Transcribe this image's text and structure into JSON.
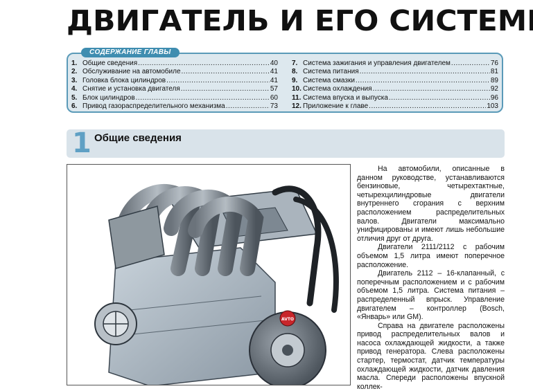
{
  "title": "ДВИГАТЕЛЬ И ЕГО СИСТЕМЫ",
  "toc": {
    "header": "СОДЕРЖАНИЕ ГЛАВЫ",
    "left": [
      {
        "num": "1.",
        "text": "Общие сведения",
        "page": "40"
      },
      {
        "num": "2.",
        "text": "Обслуживание на автомобиле",
        "page": "41"
      },
      {
        "num": "3.",
        "text": "Головка блока цилиндров",
        "page": "41"
      },
      {
        "num": "4.",
        "text": "Снятие и установка двигателя",
        "page": "57"
      },
      {
        "num": "5.",
        "text": "Блок цилиндров",
        "page": "60"
      },
      {
        "num": "6.",
        "text": "Привод газораспределительного механизма",
        "page": "73"
      }
    ],
    "right": [
      {
        "num": "7.",
        "text": "Система зажигания и управления двигателем",
        "page": "76"
      },
      {
        "num": "8.",
        "text": "Система питания",
        "page": "81"
      },
      {
        "num": "9.",
        "text": "Система смазки",
        "page": "89"
      },
      {
        "num": "10.",
        "text": "Система охлаждения",
        "page": "92"
      },
      {
        "num": "11.",
        "text": "Система впуска и выпуска",
        "page": "96"
      },
      {
        "num": "12.",
        "text": "Приложение к главе",
        "page": "103"
      }
    ]
  },
  "section": {
    "number": "1",
    "title": "Общие сведения"
  },
  "figure": {
    "logo_text": "AVTO"
  },
  "body": [
    "На автомобили, описанные в данном руководстве, устанавливаются бензиновые, четырехтактные, четырехцилиндровые двигатели внутреннего сгорания с верхним расположением распределительных валов. Двигатели максимально унифицированы и имеют лишь небольшие отличия друг от друга.",
    "Двигатели 2111/2112 с рабочим объемом 1,5 литра имеют поперечное расположение.",
    "Двигатель 2112 – 16-клапанный, с поперечным расположением и с рабочим объемом 1,5 литра. Система питания – распределенный впрыск. Управление двигателем – контроллер (Bosch, «Январь» или GM).",
    "Справа на двигателе расположены привод распределительных валов и насоса охлаждающей жидкости, а также привод генератора. Слева расположены стартер, термостат, датчик температуры охлаждающей жидкости, датчик давления масла. Спереди расположены впускной коллек-"
  ]
}
